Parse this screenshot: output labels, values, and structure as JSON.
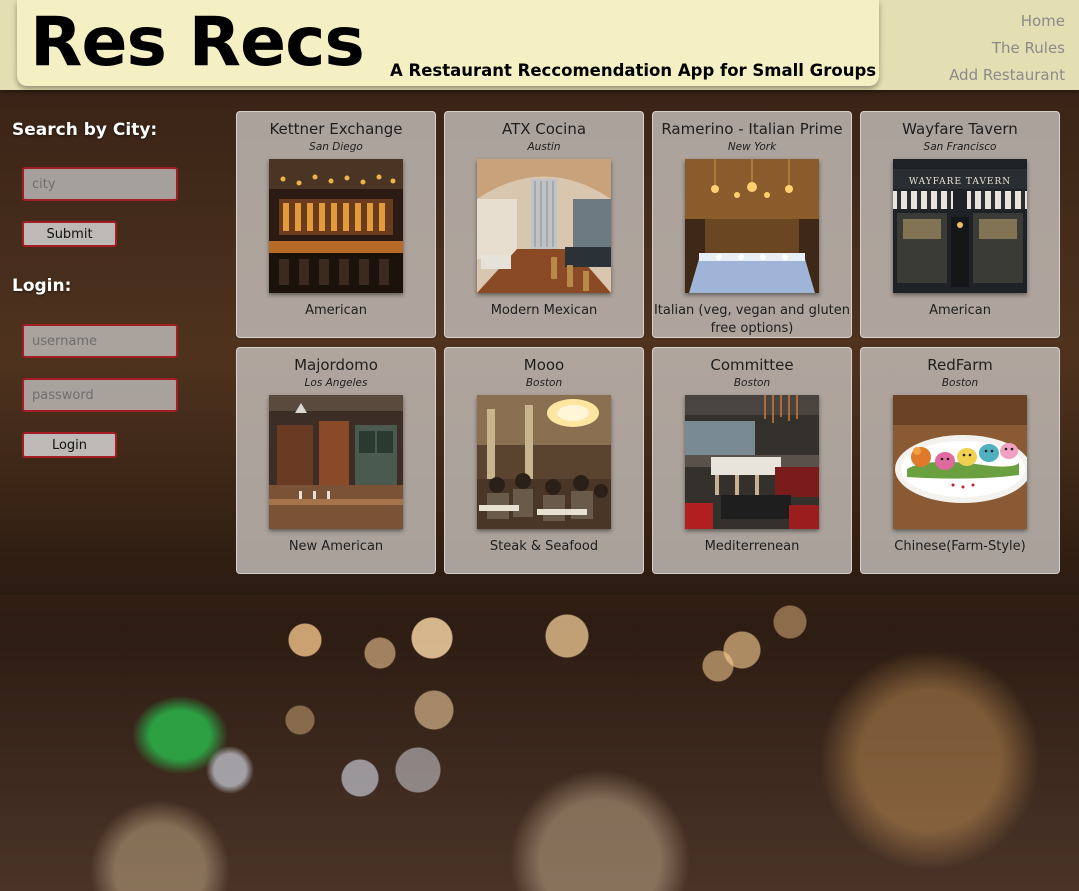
{
  "header": {
    "title": "Res Recs",
    "subtitle": "A Restaurant Reccomendation App for Small Groups",
    "nav": [
      "Home",
      "The Rules",
      "Add Restaurant"
    ]
  },
  "sidebar": {
    "search_heading": "Search by City:",
    "city_placeholder": "city",
    "submit_label": "Submit",
    "login_heading": "Login:",
    "username_placeholder": "username",
    "password_placeholder": "password",
    "login_label": "Login"
  },
  "restaurants": [
    {
      "name": "Kettner Exchange",
      "city": "San Diego",
      "cuisine": "American",
      "photo": "bar-interior"
    },
    {
      "name": "ATX Cocina",
      "city": "Austin",
      "cuisine": "Modern Mexican",
      "photo": "dining-room"
    },
    {
      "name": "Ramerino - Italian Prime",
      "city": "New York",
      "cuisine": "Italian (veg, vegan and gluten free options)",
      "photo": "chandelier-dining"
    },
    {
      "name": "Wayfare Tavern",
      "city": "San Francisco",
      "cuisine": "American",
      "photo": "storefront"
    },
    {
      "name": "Majordomo",
      "city": "Los Angeles",
      "cuisine": "New American",
      "photo": "open-kitchen"
    },
    {
      "name": "Mooo",
      "city": "Boston",
      "cuisine": "Steak & Seafood",
      "photo": "crowded-dining"
    },
    {
      "name": "Committee",
      "city": "Boston",
      "cuisine": "Mediterrenean",
      "photo": "lounge"
    },
    {
      "name": "RedFarm",
      "city": "Boston",
      "cuisine": "Chinese(Farm-Style)",
      "photo": "dumplings"
    }
  ],
  "colors": {
    "banner": "#f4f0c4",
    "input_border": "#a31d24",
    "card_bg": "#c4beba",
    "nav_text": "#8a8a8a"
  }
}
